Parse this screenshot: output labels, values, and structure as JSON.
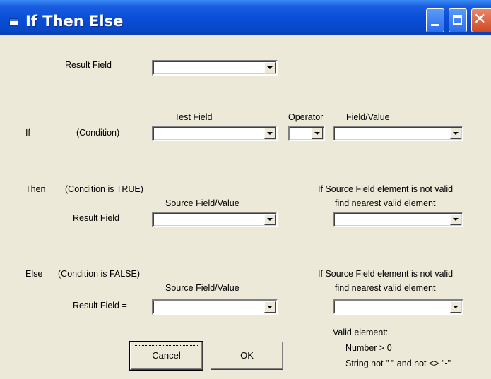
{
  "window": {
    "title": "If Then Else"
  },
  "result_section": {
    "result_field_label": "Result Field",
    "result_field_value": ""
  },
  "if_section": {
    "if_label": "If",
    "condition_label": "(Condition)",
    "test_field_header": "Test Field",
    "operator_header": "Operator",
    "field_value_header": "Field/Value",
    "test_field_value": "",
    "operator_value": "",
    "field_value_value": ""
  },
  "then_section": {
    "then_label": "Then",
    "condition_text": "(Condition is TRUE)",
    "source_header": "Source Field/Value",
    "result_field_label": "Result Field  =",
    "source_value": "",
    "invalid_line1": "If Source Field element is not valid",
    "invalid_line2": "find nearest valid element",
    "nearest_value": ""
  },
  "else_section": {
    "else_label": "Else",
    "condition_text": "(Condition is FALSE)",
    "source_header": "Source Field/Value",
    "result_field_label": "Result Field  =",
    "source_value": "",
    "invalid_line1": "If Source Field element is not valid",
    "invalid_line2": "find nearest valid element",
    "nearest_value": ""
  },
  "valid_note": {
    "title": "Valid element:",
    "number_rule": "Number > 0",
    "string_rule": "String  not \"  \" and not <> \"-\""
  },
  "buttons": {
    "cancel_label": "Cancel",
    "ok_label": "OK"
  },
  "icons": {
    "app": "window-app-icon",
    "minimize": "minimize-icon",
    "maximize": "maximize-icon",
    "close": "close-icon"
  }
}
